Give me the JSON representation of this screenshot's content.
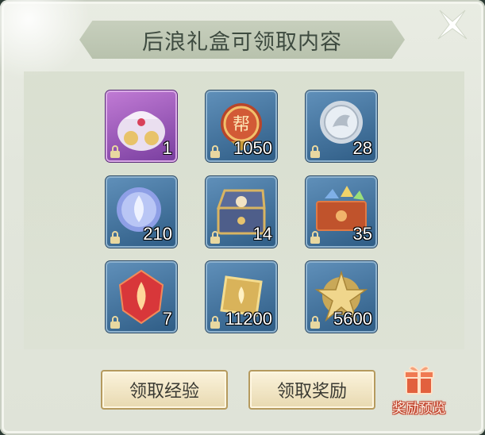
{
  "title": "后浪礼盒可领取内容",
  "items": [
    {
      "name": "gift-bag-icon",
      "count": "1"
    },
    {
      "name": "guild-coin-icon",
      "count": "1050"
    },
    {
      "name": "silver-dragon-coin-icon",
      "count": "28"
    },
    {
      "name": "spirit-orb-icon",
      "count": "210"
    },
    {
      "name": "treasure-chest-icon",
      "count": "14"
    },
    {
      "name": "gem-box-icon",
      "count": "35"
    },
    {
      "name": "flame-crystal-icon",
      "count": "7"
    },
    {
      "name": "gold-token-icon",
      "count": "11200"
    },
    {
      "name": "star-emblem-icon",
      "count": "5600"
    }
  ],
  "buttons": {
    "claim_exp": "领取经验",
    "claim_reward": "领取奖励"
  },
  "preview": {
    "label": "奖励预览",
    "icon": "gift-box-icon"
  },
  "close": {
    "icon": "close-icon"
  },
  "colors": {
    "panel_bg": "#e4e8de",
    "slot_blue": "#4878a2",
    "slot_purple": "#a35ec2",
    "button_bg": "#f3e8c8",
    "preview_red": "#e25d3c"
  }
}
